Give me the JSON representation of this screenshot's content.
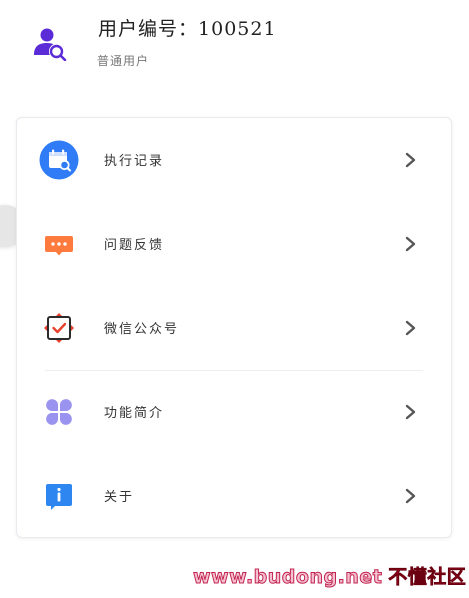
{
  "header": {
    "user_id_label": "用户编号：",
    "user_id_value": "100521",
    "role": "普通用户",
    "icon": "user-search-icon"
  },
  "menu": {
    "items": [
      {
        "label": "执行记录",
        "icon": "calendar-search-icon",
        "arrow_icon": "chevron-right-icon"
      },
      {
        "label": "问题反馈",
        "icon": "chat-bubble-icon",
        "arrow_icon": "chevron-right-icon"
      },
      {
        "label": "微信公众号",
        "icon": "wechat-official-icon",
        "arrow_icon": "chevron-right-icon"
      },
      {
        "label": "功能简介",
        "icon": "four-petal-grid-icon",
        "arrow_icon": "chevron-right-icon"
      },
      {
        "label": "关于",
        "icon": "info-icon",
        "arrow_icon": "chevron-right-icon"
      }
    ]
  },
  "watermark": {
    "url": "www.budong.net",
    "brand": "不懂社区"
  },
  "colors": {
    "purple": "#5b2bd8",
    "blue": "#2f7cf6",
    "orange": "#ff7a3d",
    "red": "#e8412d",
    "lavender": "#9b93f0",
    "info_blue": "#2e86f0",
    "arrow": "#555555"
  }
}
